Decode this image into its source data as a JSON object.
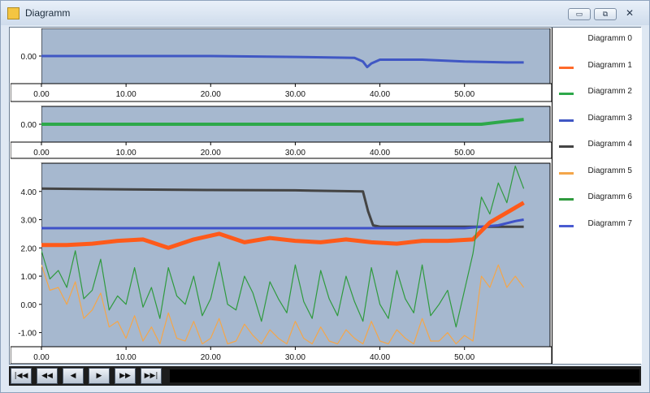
{
  "window": {
    "title": "Diagramm",
    "buttons": [
      "▭",
      "⧉",
      "✕"
    ]
  },
  "legend": {
    "items": [
      {
        "label": "Diagramm 0",
        "color": "#ffffff"
      },
      {
        "label": "Diagramm 1",
        "color": "#ff6a2a"
      },
      {
        "label": "Diagramm 2",
        "color": "#2da84a"
      },
      {
        "label": "Diagramm 3",
        "color": "#4057c4"
      },
      {
        "label": "Diagramm 4",
        "color": "#444444"
      },
      {
        "label": "Diagramm 5",
        "color": "#f4a64a"
      },
      {
        "label": "Diagramm 6",
        "color": "#2f9a3e"
      },
      {
        "label": "Diagramm 7",
        "color": "#4a5bd1"
      }
    ]
  },
  "chart_data": [
    {
      "type": "line",
      "xlim": [
        0,
        58
      ],
      "x_ticks": [
        "0.00",
        "10.00",
        "20.00",
        "30.00",
        "40.00",
        "50.00"
      ],
      "y_ticks": [
        "0.00"
      ],
      "series": [
        {
          "name": "Diagramm 3",
          "color": "#4057c4",
          "x": [
            0,
            10,
            20,
            30,
            37,
            38,
            38.5,
            39,
            40,
            45,
            50,
            55,
            57
          ],
          "y": [
            0.0,
            0.0,
            0.0,
            -0.005,
            -0.01,
            -0.03,
            -0.06,
            -0.04,
            -0.02,
            -0.02,
            -0.03,
            -0.035,
            -0.035
          ]
        }
      ]
    },
    {
      "type": "line",
      "xlim": [
        0,
        58
      ],
      "x_ticks": [
        "0.00",
        "10.00",
        "20.00",
        "30.00",
        "40.00",
        "50.00"
      ],
      "y_ticks": [
        "0.00"
      ],
      "series": [
        {
          "name": "Diagramm 2",
          "color": "#2da84a",
          "x": [
            0,
            20,
            40,
            52,
            55,
            57
          ],
          "y": [
            0.0,
            0.0,
            0.0,
            0.0,
            0.05,
            0.08
          ]
        }
      ]
    },
    {
      "type": "line",
      "xlim": [
        0,
        58
      ],
      "ylim": [
        -1.5,
        5.0
      ],
      "x_ticks": [
        "0.00",
        "10.00",
        "20.00",
        "30.00",
        "40.00",
        "50.00"
      ],
      "y_ticks": [
        "4.00",
        "3.00",
        "2.00",
        "1.00",
        "0.00",
        "-1.00"
      ],
      "series": [
        {
          "name": "Diagramm 4",
          "color": "#444444",
          "x": [
            0,
            10,
            20,
            30,
            38,
            38.6,
            39.2,
            40,
            45,
            50,
            55,
            57
          ],
          "y": [
            4.1,
            4.07,
            4.05,
            4.04,
            4.0,
            3.3,
            2.8,
            2.75,
            2.75,
            2.75,
            2.75,
            2.75
          ]
        },
        {
          "name": "Diagramm 7",
          "color": "#3f52c8",
          "x": [
            0,
            20,
            40,
            50,
            52,
            54,
            56,
            57
          ],
          "y": [
            2.7,
            2.7,
            2.7,
            2.7,
            2.75,
            2.8,
            2.95,
            3.0
          ]
        },
        {
          "name": "Diagramm 1",
          "color": "#ff5a1a",
          "x": [
            0,
            3,
            6,
            9,
            12,
            15,
            18,
            21,
            24,
            27,
            30,
            33,
            36,
            39,
            42,
            45,
            48,
            51,
            53,
            55,
            57
          ],
          "y": [
            2.1,
            2.1,
            2.15,
            2.25,
            2.3,
            2.0,
            2.3,
            2.5,
            2.2,
            2.35,
            2.25,
            2.2,
            2.3,
            2.2,
            2.15,
            2.25,
            2.25,
            2.3,
            2.9,
            3.25,
            3.6
          ]
        },
        {
          "name": "Diagramm 6",
          "color": "#2f9a3e",
          "x": [
            0,
            1,
            2,
            3,
            4,
            5,
            6,
            7,
            8,
            9,
            10,
            11,
            12,
            13,
            14,
            15,
            16,
            17,
            18,
            19,
            20,
            21,
            22,
            23,
            24,
            25,
            26,
            27,
            28,
            29,
            30,
            31,
            32,
            33,
            34,
            35,
            36,
            37,
            38,
            39,
            40,
            41,
            42,
            43,
            44,
            45,
            46,
            47,
            48,
            49,
            50,
            51,
            52,
            53,
            54,
            55,
            56,
            57
          ],
          "y": [
            1.9,
            0.9,
            1.2,
            0.6,
            1.9,
            0.2,
            0.5,
            1.6,
            -0.2,
            0.3,
            0.0,
            1.3,
            -0.1,
            0.6,
            -0.5,
            1.3,
            0.3,
            0.0,
            1.0,
            -0.4,
            0.2,
            1.5,
            0.0,
            -0.2,
            1.0,
            0.4,
            -0.6,
            0.8,
            0.2,
            -0.3,
            1.4,
            0.1,
            -0.5,
            1.2,
            0.2,
            -0.4,
            1.0,
            0.1,
            -0.6,
            1.3,
            0.0,
            -0.5,
            1.2,
            0.2,
            -0.3,
            1.4,
            -0.4,
            0.0,
            0.5,
            -0.8,
            0.5,
            1.8,
            3.8,
            3.2,
            4.3,
            3.6,
            4.9,
            4.1
          ]
        },
        {
          "name": "Diagramm 5",
          "color": "#f4a64a",
          "x": [
            0,
            1,
            2,
            3,
            4,
            5,
            6,
            7,
            8,
            9,
            10,
            11,
            12,
            13,
            14,
            15,
            16,
            17,
            18,
            19,
            20,
            21,
            22,
            23,
            24,
            25,
            26,
            27,
            28,
            29,
            30,
            31,
            32,
            33,
            34,
            35,
            36,
            37,
            38,
            39,
            40,
            41,
            42,
            43,
            44,
            45,
            46,
            47,
            48,
            49,
            50,
            51,
            52,
            53,
            54,
            55,
            56,
            57
          ],
          "y": [
            1.4,
            0.5,
            0.6,
            0.0,
            0.8,
            -0.5,
            -0.2,
            0.4,
            -0.8,
            -0.6,
            -1.2,
            -0.4,
            -1.3,
            -0.8,
            -1.4,
            -0.3,
            -1.2,
            -1.3,
            -0.6,
            -1.4,
            -1.2,
            -0.5,
            -1.4,
            -1.3,
            -0.7,
            -1.1,
            -1.4,
            -0.9,
            -1.2,
            -1.4,
            -0.6,
            -1.2,
            -1.4,
            -0.8,
            -1.3,
            -1.4,
            -0.9,
            -1.2,
            -1.4,
            -0.6,
            -1.3,
            -1.4,
            -0.9,
            -1.2,
            -1.4,
            -0.5,
            -1.3,
            -1.3,
            -1.0,
            -1.4,
            -1.1,
            -1.3,
            1.0,
            0.6,
            1.4,
            0.6,
            1.0,
            0.6
          ]
        }
      ]
    }
  ],
  "navbar": {
    "buttons": [
      "|◀◀",
      "◀◀",
      "◀",
      "▶",
      "▶▶",
      "▶▶|"
    ]
  }
}
